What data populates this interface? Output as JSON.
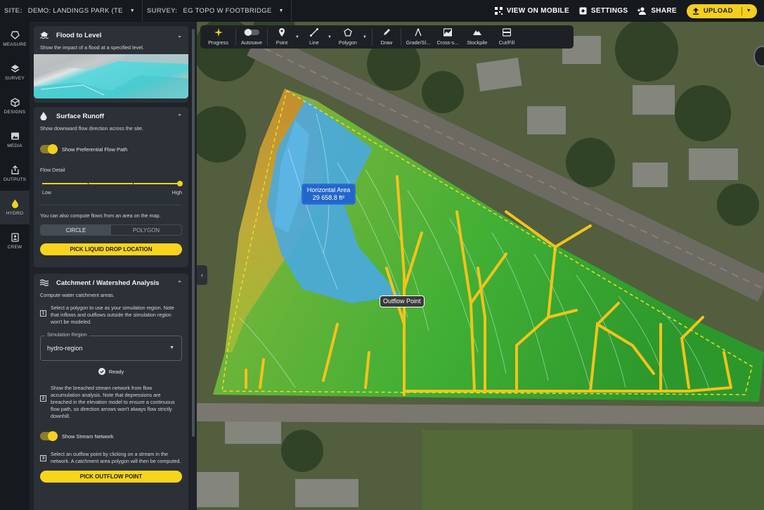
{
  "topbar": {
    "site_label": "SITE:",
    "site_value": "DEMO: LANDINGS PARK (TE",
    "survey_label": "SURVEY:",
    "survey_value": "EG TOPO W FOOTBRIDGE",
    "view_mobile": "VIEW ON MOBILE",
    "settings": "SETTINGS",
    "share": "SHARE",
    "upload": "UPLOAD"
  },
  "rail": {
    "items": [
      {
        "label": "MEASURE",
        "icon": "measure-icon"
      },
      {
        "label": "SURVEY",
        "icon": "layers-icon"
      },
      {
        "label": "DESIGNS",
        "icon": "cube-icon"
      },
      {
        "label": "MEDIA",
        "icon": "image-icon"
      },
      {
        "label": "OUTPUTS",
        "icon": "export-icon"
      },
      {
        "label": "HYDRO",
        "icon": "drop-icon"
      },
      {
        "label": "CREW",
        "icon": "crew-icon"
      }
    ]
  },
  "flood": {
    "title": "Flood to Level",
    "desc": "Show the impact of a flood at a specified level."
  },
  "runoff": {
    "title": "Surface Runoff",
    "desc": "Show downward flow direction across the site.",
    "toggle_label": "Show Preferential Flow Path",
    "flow_detail": "Flow Detail",
    "low": "Low",
    "high": "High",
    "slider_value": 1.0,
    "area_text": "You can also compute flows from an area on the map.",
    "circle": "CIRCLE",
    "polygon": "POLYGON",
    "pick_button": "PICK LIQUID DROP LOCATION"
  },
  "catchment": {
    "title": "Catchment / Watershed Analysis",
    "desc": "Compute water catchment areas.",
    "step1": "Select a polygon to use as your simulation region. Note that inflows and outflows outside the simulation region won't be modeled.",
    "region_label": "Simulation Region",
    "region_value": "hydro-region",
    "ready": "Ready",
    "step2": "Show the breached stream network from flow accumulation analysis. Note that depressions are breached in the elevation model to ensure a continuous flow path, so direction arrows won't always flow strictly downhill.",
    "stream_toggle": "Show Stream Network",
    "step3": "Select an outflow point by clicking on a stream in the network. A catchment area polygon will then be computed.",
    "outflow_button": "PICK OUTFLOW POINT"
  },
  "toolbar": {
    "tools": [
      "Progress",
      "Autosave",
      "Point",
      "Line",
      "Polygon",
      "Draw",
      "Grade/Sl...",
      "Cross-s...",
      "Stockpile",
      "Cut/Fill"
    ]
  },
  "map": {
    "area_label": "Horizontal Area",
    "area_value": "29 658.8 ft²",
    "outflow_label": "Outflow Point"
  },
  "colors": {
    "accent": "#f5cf1d",
    "panel": "#2c3138",
    "dark": "#16191d"
  }
}
